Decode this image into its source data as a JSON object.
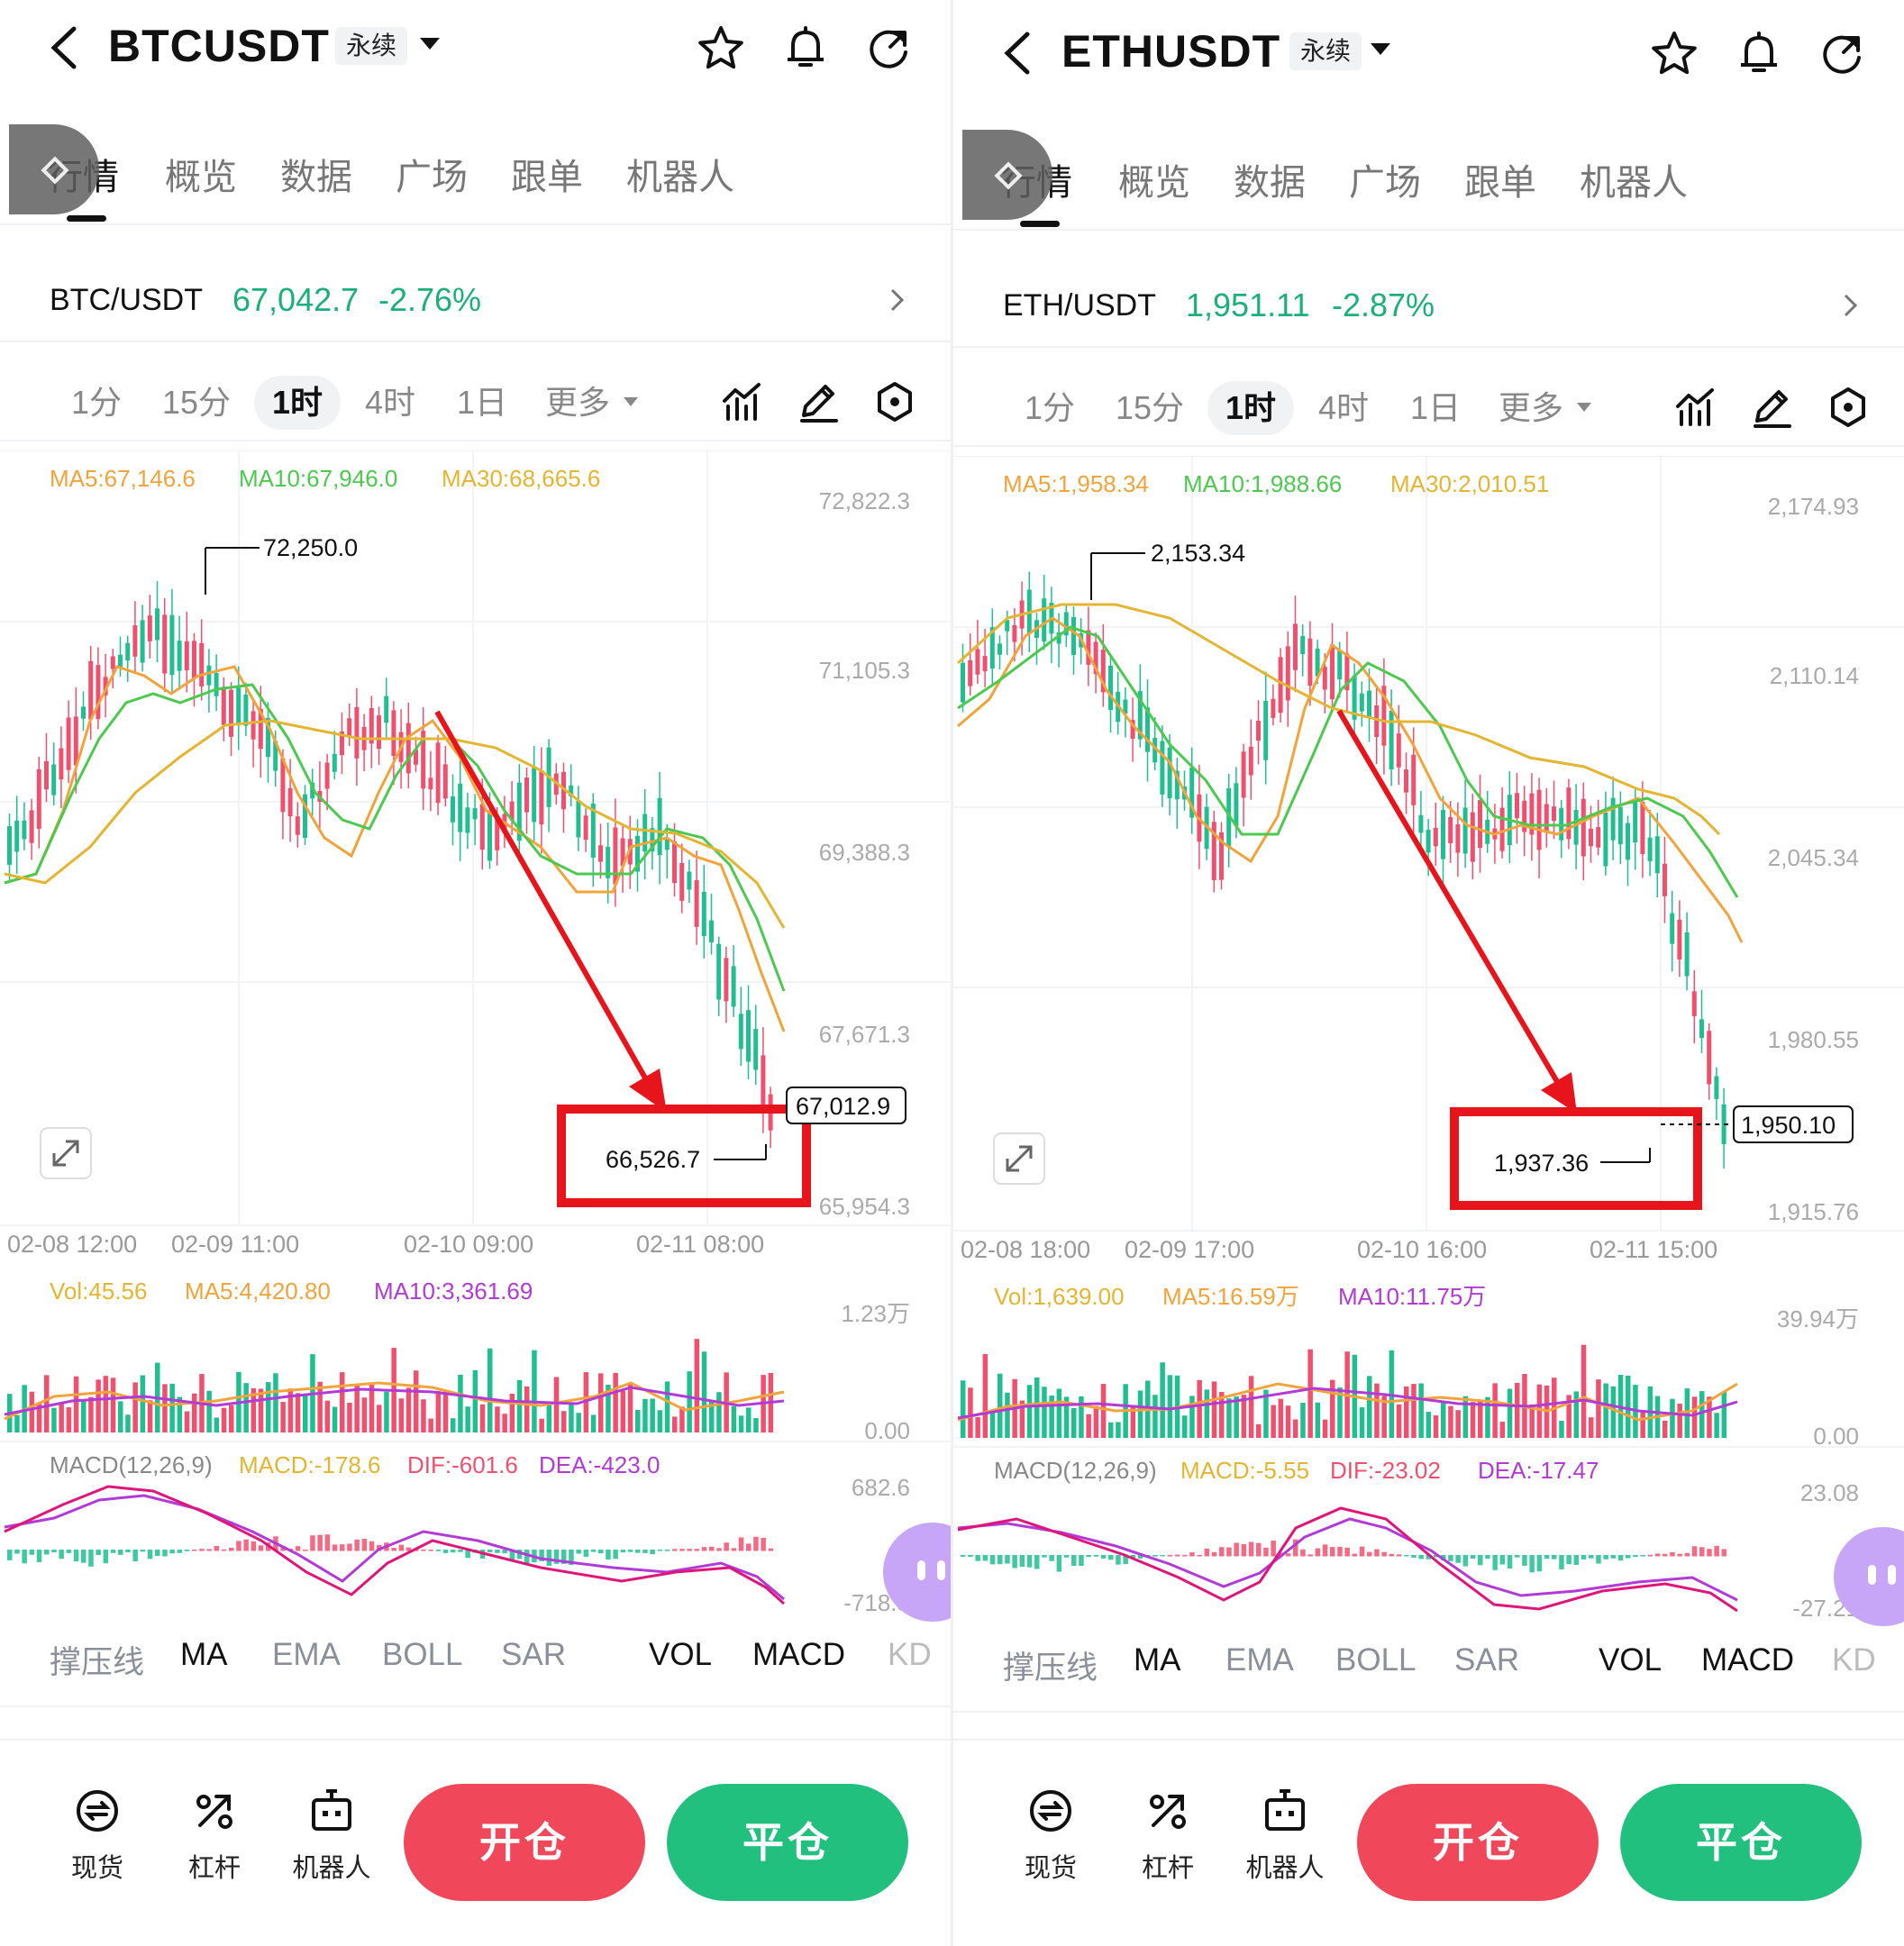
{
  "panels": [
    {
      "symbol": "BTCUSDT",
      "contract": "永续",
      "tabs": [
        "行情",
        "概览",
        "数据",
        "广场",
        "跟单",
        "机器人"
      ],
      "pair_name": "BTC/USDT",
      "pair_price": "67,042.7",
      "pair_change": "-2.76%",
      "timeframes": [
        "1分",
        "15分",
        "1时",
        "4时",
        "1日",
        "更多"
      ],
      "active_timeframe": "1时",
      "ma_legend": {
        "ma5": "MA5:67,146.6",
        "ma10": "MA10:67,946.0",
        "ma30": "MA30:68,665.6"
      },
      "y_ticks": [
        "72,822.3",
        "71,105.3",
        "69,388.3",
        "67,671.3",
        "65,954.3"
      ],
      "x_ticks": [
        "02-08 12:00",
        "02-09 11:00",
        "02-10 09:00",
        "02-11 08:00"
      ],
      "high_label": "72,250.0",
      "low_label": "66,526.7",
      "last_price_tag": "67,012.9",
      "vol_legend": {
        "vol": "Vol:45.56",
        "ma5": "MA5:4,420.80",
        "ma10": "MA10:3,361.69"
      },
      "vol_ticks": [
        "1.23万",
        "0.00"
      ],
      "macd_legend": {
        "name": "MACD(12,26,9)",
        "macd": "MACD:-178.6",
        "dif": "DIF:-601.6",
        "dea": "DEA:-423.0"
      },
      "macd_ticks": [
        "682.6",
        "-718.3"
      ],
      "indicators": [
        "撑压线",
        "MA",
        "EMA",
        "BOLL",
        "SAR",
        "VOL",
        "MACD",
        "KD"
      ],
      "bottom_nav": [
        "现货",
        "杠杆",
        "机器人"
      ],
      "open_btn": "开仓",
      "close_btn": "平仓"
    },
    {
      "symbol": "ETHUSDT",
      "contract": "永续",
      "tabs": [
        "行情",
        "概览",
        "数据",
        "广场",
        "跟单",
        "机器人"
      ],
      "pair_name": "ETH/USDT",
      "pair_price": "1,951.11",
      "pair_change": "-2.87%",
      "timeframes": [
        "1分",
        "15分",
        "1时",
        "4时",
        "1日",
        "更多"
      ],
      "active_timeframe": "1时",
      "ma_legend": {
        "ma5": "MA5:1,958.34",
        "ma10": "MA10:1,988.66",
        "ma30": "MA30:2,010.51"
      },
      "y_ticks": [
        "2,174.93",
        "2,110.14",
        "2,045.34",
        "1,980.55",
        "1,915.76"
      ],
      "x_ticks": [
        "02-08 18:00",
        "02-09 17:00",
        "02-10 16:00",
        "02-11 15:00"
      ],
      "high_label": "2,153.34",
      "low_label": "1,937.36",
      "last_price_tag": "1,950.10",
      "vol_legend": {
        "vol": "Vol:1,639.00",
        "ma5": "MA5:16.59万",
        "ma10": "MA10:11.75万"
      },
      "vol_ticks": [
        "39.94万",
        "0.00"
      ],
      "macd_legend": {
        "name": "MACD(12,26,9)",
        "macd": "MACD:-5.55",
        "dif": "DIF:-23.02",
        "dea": "DEA:-17.47"
      },
      "macd_ticks": [
        "23.08",
        "-27.21"
      ],
      "indicators": [
        "撑压线",
        "MA",
        "EMA",
        "BOLL",
        "SAR",
        "VOL",
        "MACD",
        "KD"
      ],
      "bottom_nav": [
        "现货",
        "杠杆",
        "机器人"
      ],
      "open_btn": "开仓",
      "close_btn": "平仓"
    }
  ],
  "colors": {
    "up": "#1fbf8f",
    "down": "#f0506e",
    "ma5": "#f2a33a",
    "ma10": "#4cc94f",
    "ma30": "#e4b530",
    "annotation": "#e8141c",
    "pair_price": "#1bb07a",
    "open_btn": "#f1475a",
    "close_btn": "#22c07f",
    "vol_ma10": "#b23ad6"
  },
  "icons": [
    "back-arrow-icon",
    "star-icon",
    "bell-icon",
    "refresh-icon",
    "indicator-icon",
    "pencil-icon",
    "settings-hex-icon",
    "expand-icon",
    "spot-icon",
    "leverage-icon",
    "robot-icon"
  ]
}
